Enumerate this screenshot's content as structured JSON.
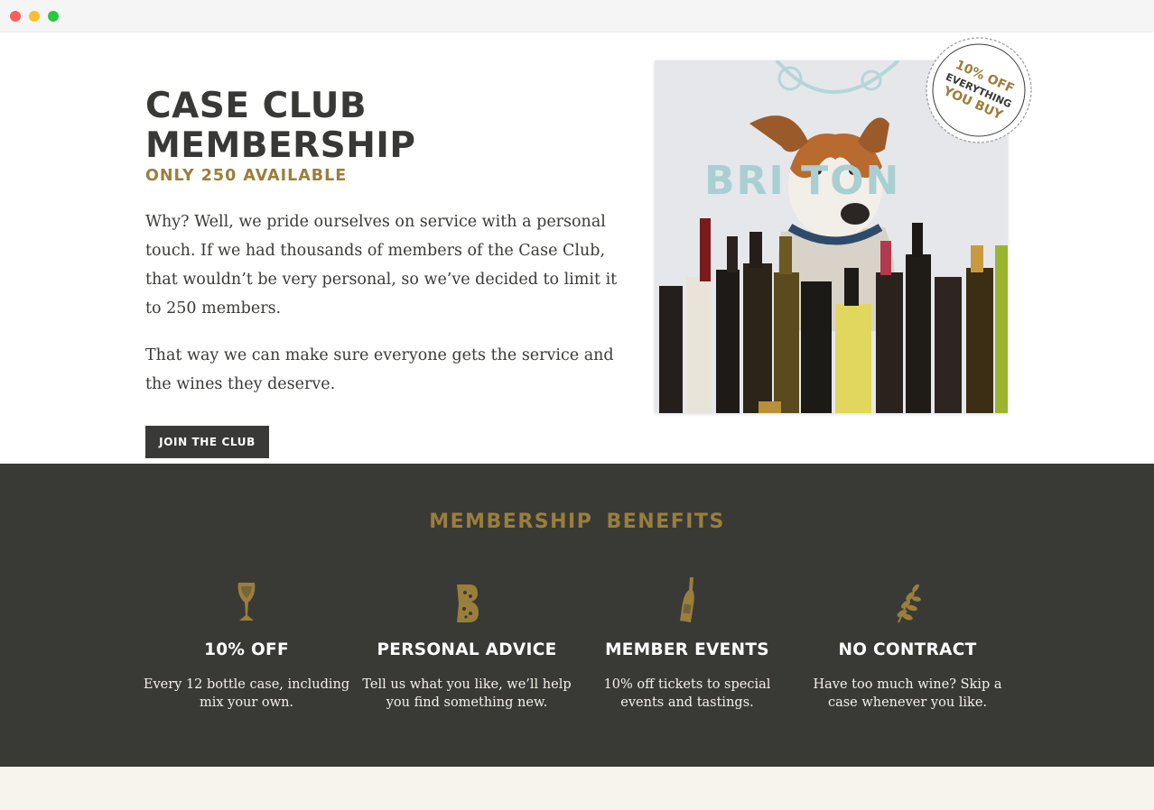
{
  "hero": {
    "title": "CASE CLUB MEMBERSHIP",
    "subtitle": "ONLY 250 AVAILABLE",
    "paragraph1": "Why? Well, we pride ourselves on service with a personal touch. If we had thousands of members of the Case Club, that wouldn’t be very personal, so we’ve decided to limit it to 250 members.",
    "paragraph2": "That way we can make sure everyone gets the service and the wines they deserve.",
    "join_button": "JOIN THE CLUB",
    "photo_sign_text": "BRI   TON",
    "badge": {
      "line1": "10% OFF",
      "line2": "EVERYTHING",
      "line3": "YOU BUY"
    }
  },
  "benefits": {
    "title": "MEMBERSHIP  BENEFITS",
    "items": [
      {
        "icon": "wine-glass-icon",
        "title": "10% OFF",
        "text": "Every 12 bottle case, including mix your own."
      },
      {
        "icon": "letter-b-icon",
        "title": "PERSONAL ADVICE",
        "text": "Tell us what you like, we’ll help you find something new."
      },
      {
        "icon": "wine-bottle-icon",
        "title": "MEMBER EVENTS",
        "text": "10% off tickets to special events and tastings."
      },
      {
        "icon": "laurel-branch-icon",
        "title": "NO CONTRACT",
        "text": "Have too much wine? Skip a case whenever you like."
      }
    ]
  },
  "colors": {
    "accent": "#9a7e3b",
    "dark": "#393a36",
    "text": "#3a3a38",
    "footer": "#f7f4ec"
  }
}
